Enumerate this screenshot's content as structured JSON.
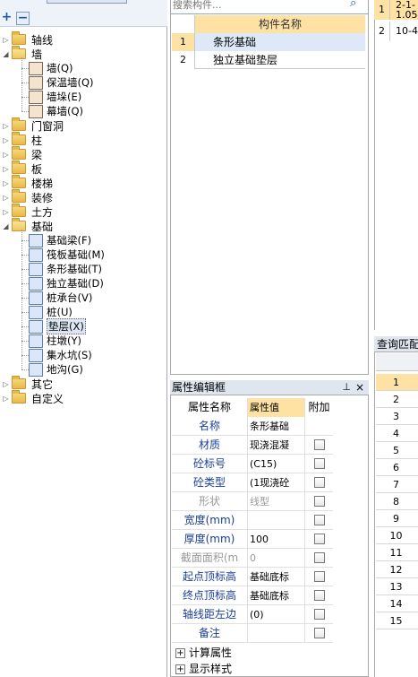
{
  "tree": {
    "nodes": [
      {
        "label": "轴线",
        "expanded": false
      },
      {
        "label": "墙",
        "expanded": true
      },
      {
        "label": "门窗洞",
        "expanded": false
      },
      {
        "label": "柱",
        "expanded": false
      },
      {
        "label": "梁",
        "expanded": false
      },
      {
        "label": "板",
        "expanded": false
      },
      {
        "label": "楼梯",
        "expanded": false
      },
      {
        "label": "装修",
        "expanded": false
      },
      {
        "label": "土方",
        "expanded": false
      },
      {
        "label": "基础",
        "expanded": true
      },
      {
        "label": "其它",
        "expanded": false
      },
      {
        "label": "自定义",
        "expanded": false
      }
    ],
    "wall_children": [
      "墙(Q)",
      "保温墙(Q)",
      "墙垛(E)",
      "幕墙(Q)"
    ],
    "foundation_children": [
      "基础梁(F)",
      "筏板基础(M)",
      "条形基础(T)",
      "独立基础(D)",
      "桩承台(V)",
      "桩(U)",
      "垫层(X)",
      "柱墩(Y)",
      "集水坑(S)",
      "地沟(G)"
    ],
    "selected_child": "垫层(X)"
  },
  "search": {
    "placeholder": "搜索构件..."
  },
  "component_list": {
    "header": "构件名称",
    "rows": [
      {
        "num": "1",
        "name": "条形基础",
        "selected": true
      },
      {
        "num": "2",
        "name": "独立基础垫层",
        "selected": false
      }
    ]
  },
  "property_panel": {
    "title": "属性编辑框",
    "pin_glyph": "ᵖ",
    "close_glyph": "×",
    "header": {
      "name": "属性名称",
      "value": "属性值",
      "extra": "附加"
    },
    "rows": [
      {
        "name": "名称",
        "value": "条形基础",
        "disabled": false,
        "checkbox": false
      },
      {
        "name": "材质",
        "value": "现浇混凝",
        "disabled": false,
        "checkbox": true
      },
      {
        "name": "砼标号",
        "value": "(C15)",
        "disabled": false,
        "checkbox": true
      },
      {
        "name": "砼类型",
        "value": "(1现浇砼",
        "disabled": false,
        "checkbox": true
      },
      {
        "name": "形状",
        "value": "线型",
        "disabled": true,
        "checkbox": true
      },
      {
        "name": "宽度(mm)",
        "value": "",
        "disabled": false,
        "checkbox": true
      },
      {
        "name": "厚度(mm)",
        "value": "100",
        "disabled": false,
        "checkbox": true
      },
      {
        "name": "截面面积(m",
        "value": "0",
        "disabled": true,
        "checkbox": true
      },
      {
        "name": "起点顶标高",
        "value": "基础底标",
        "disabled": false,
        "checkbox": true
      },
      {
        "name": "终点顶标高",
        "value": "基础底标",
        "disabled": false,
        "checkbox": true
      },
      {
        "name": "轴线距左边",
        "value": "(0)",
        "disabled": false,
        "checkbox": true
      },
      {
        "name": "备注",
        "value": "",
        "disabled": false,
        "checkbox": true
      }
    ],
    "groups": [
      "计算属性",
      "显示样式"
    ]
  },
  "right_top": {
    "rows": [
      {
        "num": "1",
        "text": "2-1-",
        "text2": "1.05"
      },
      {
        "num": "2",
        "text": "10-4",
        "text2": ""
      }
    ]
  },
  "query_panel": {
    "title": "查询匹配",
    "rows": [
      "1",
      "2",
      "3",
      "4",
      "5",
      "6",
      "7",
      "8",
      "9",
      "10",
      "11",
      "12",
      "13",
      "14",
      "15"
    ],
    "selected": "1"
  }
}
